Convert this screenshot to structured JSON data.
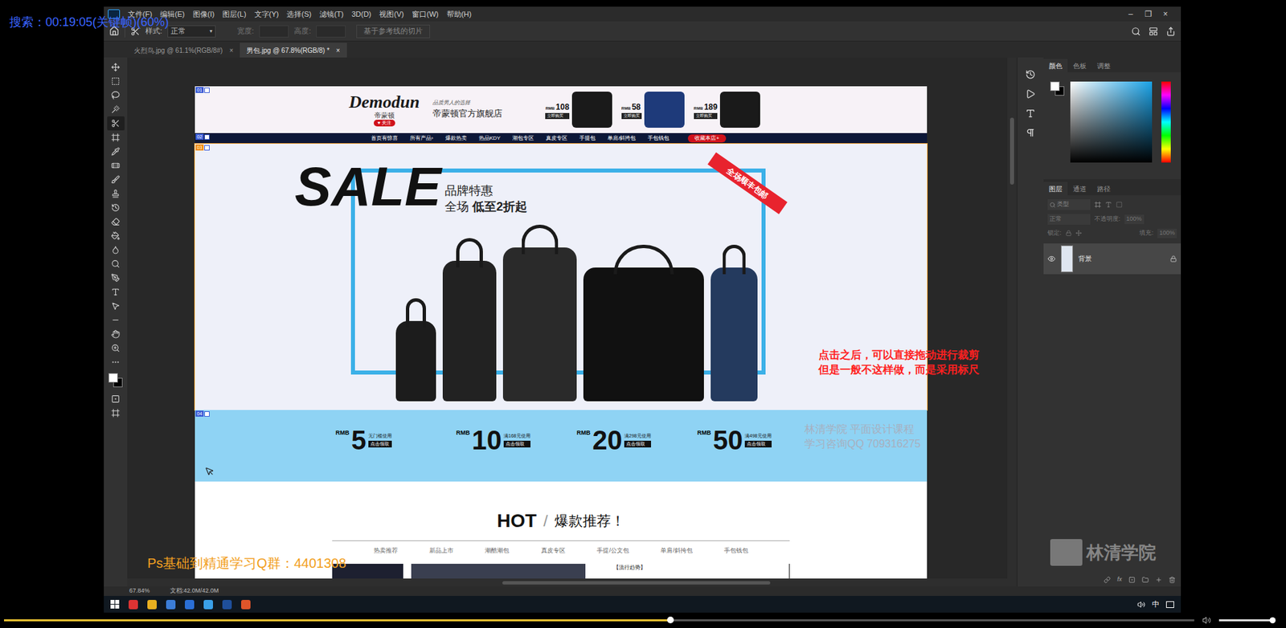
{
  "video_overlay": {
    "search_label": "搜索：00:19:05(关键帧)(60%)"
  },
  "app": {
    "menu": [
      "文件(F)",
      "编辑(E)",
      "图像(I)",
      "图层(L)",
      "文字(Y)",
      "选择(S)",
      "滤镜(T)",
      "3D(D)",
      "视图(V)",
      "窗口(W)",
      "帮助(H)"
    ],
    "window_controls": [
      "–",
      "❐",
      "×"
    ],
    "options_bar": {
      "style_label": "样式:",
      "style_value": "正常",
      "width_label": "宽度:",
      "height_label": "高度:",
      "guide_slices_button": "基于参考线的切片"
    },
    "doc_tabs": [
      {
        "label": "火烈鸟.jpg @ 61.1%(RGB/8#)",
        "selected": false,
        "close": "×"
      },
      {
        "label": "男包.jpg @ 67.8%(RGB/8) *",
        "selected": true,
        "close": "×"
      }
    ],
    "tools": [
      {
        "selected": false
      },
      {
        "selected": false
      },
      {
        "selected": false
      },
      {
        "selected": false
      },
      {
        "selected": true
      },
      {
        "selected": false
      },
      {
        "selected": false
      },
      {
        "selected": false
      },
      {
        "selected": false
      },
      {
        "selected": false
      },
      {
        "selected": false
      },
      {
        "selected": false
      },
      {
        "selected": false
      },
      {
        "selected": false
      },
      {
        "selected": false
      },
      {
        "selected": false
      },
      {
        "selected": false
      },
      {
        "selected": false
      },
      {
        "selected": false
      },
      {
        "selected": false
      },
      {
        "selected": false
      },
      {
        "selected": false
      }
    ],
    "status_bar": {
      "zoom": "67.84%",
      "doc_size": "文档:42.0M/42.0M"
    }
  },
  "color_panel": {
    "tabs": [
      {
        "label": "颜色",
        "selected": true
      },
      {
        "label": "色板",
        "selected": false
      },
      {
        "label": "调整",
        "selected": false
      }
    ]
  },
  "layers_panel": {
    "tabs": [
      {
        "label": "图层",
        "selected": true
      },
      {
        "label": "通道",
        "selected": false
      },
      {
        "label": "路径",
        "selected": false
      }
    ],
    "filter": "类型",
    "blend_mode": "正常",
    "opacity_label": "不透明度:",
    "opacity": "100%",
    "lock_label": "锁定:",
    "fill_label": "填充:",
    "fill": "100%",
    "layers": [
      {
        "name": "背景",
        "visible": true,
        "locked": true,
        "selected": true
      }
    ]
  },
  "document": {
    "slices": [
      {
        "label": "01",
        "selected": false
      },
      {
        "label": "02",
        "selected": false
      },
      {
        "label": "03",
        "selected": true
      },
      {
        "label": "04",
        "selected": false
      }
    ],
    "header": {
      "brand": "Demodun",
      "brand_cn": "帝蒙顿",
      "badge": "♥ 关注",
      "tagline": "品质男人的选择",
      "store": "帝蒙顿官方旗舰店",
      "products": [
        {
          "currency": "RMB",
          "price": "108",
          "buy": "立即购买"
        },
        {
          "currency": "RMB",
          "price": "58",
          "buy": "立即购买"
        },
        {
          "currency": "RMB",
          "price": "189",
          "buy": "立即购买"
        }
      ]
    },
    "nav": [
      {
        "label": "首页有惊喜",
        "highlight": false
      },
      {
        "label": "所有产品›",
        "highlight": false
      },
      {
        "label": "爆款热卖",
        "highlight": false
      },
      {
        "label": "热品KDY",
        "highlight": false
      },
      {
        "label": "潮包专区",
        "highlight": false
      },
      {
        "label": "真皮专区",
        "highlight": false
      },
      {
        "label": "手提包",
        "highlight": false
      },
      {
        "label": "单肩/斜挎包",
        "highlight": false
      },
      {
        "label": "手包钱包",
        "highlight": false
      },
      {
        "label": "收藏本店+",
        "highlight": true
      }
    ],
    "banner": {
      "sale": "SALE",
      "line1": "品牌特惠",
      "line2_prefix": "全场",
      "line2": "低至2折起",
      "ribbon": "全场顺丰包邮"
    },
    "coupons": [
      {
        "currency": "RMB",
        "amount": "5",
        "condition": "无门槛使用",
        "action": "点击领取"
      },
      {
        "currency": "RMB",
        "amount": "10",
        "condition": "满168元使用",
        "action": "点击领取"
      },
      {
        "currency": "RMB",
        "amount": "20",
        "condition": "满298元使用",
        "action": "点击领取"
      },
      {
        "currency": "RMB",
        "amount": "50",
        "condition": "满498元使用",
        "action": "点击领取"
      }
    ],
    "hot": {
      "title": "HOT",
      "slash": "/",
      "subtitle": "爆款推荐！",
      "tabs": [
        "热卖推荐",
        "新品上市",
        "潮酷潮包",
        "真皮专区",
        "手提/公文包",
        "单肩/斜挎包",
        "手包钱包"
      ],
      "tag": "【流行趋势】"
    }
  },
  "annotations": {
    "note_lines": [
      "点击之后，可以直接拖动进行裁剪",
      "但是一般不这样做，而是采用标尺"
    ],
    "watermark_lines": [
      "林清学院  平面设计课程",
      "学习咨询QQ 709316275"
    ],
    "qq_group": "Ps基础到精通学习Q群：4401308",
    "logo": "林清学院"
  },
  "taskbar": {
    "tray_ime": "中"
  },
  "player": {
    "progress": 0.56,
    "volume": 0.95
  }
}
